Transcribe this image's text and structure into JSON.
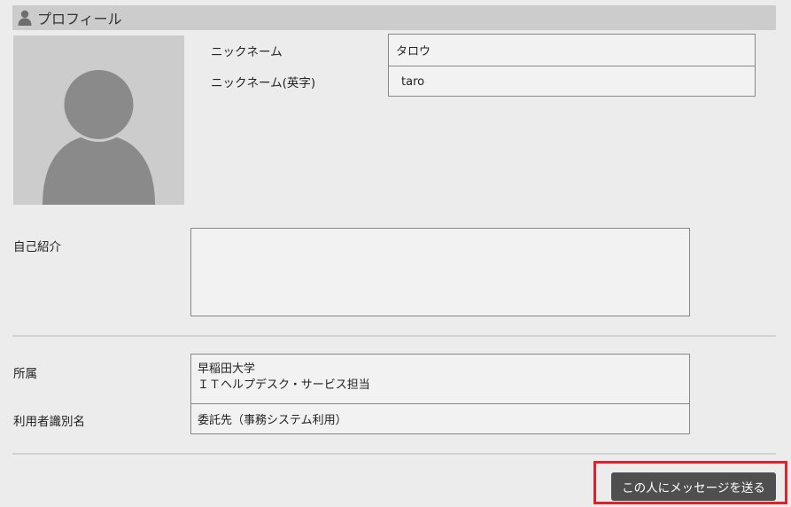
{
  "header": {
    "icon": "user-icon",
    "title": "プロフィール"
  },
  "profile": {
    "avatar_icon": "avatar-placeholder-icon",
    "nickname_label": "ニックネーム",
    "nickname_value": "タロウ",
    "nickname_en_label": "ニックネーム(英字)",
    "nickname_en_value": "taro",
    "intro_label": "自己紹介",
    "intro_value": ""
  },
  "affiliation": {
    "label": "所属",
    "lines": [
      "早稲田大学",
      "ＩＴヘルプデスク・サービス担当"
    ],
    "user_id_label": "利用者識別名",
    "user_id_value": "委託先（事務システム利用）"
  },
  "actions": {
    "send_message_label": "この人にメッセージを送る"
  },
  "colors": {
    "background": "#ececec",
    "header_bg": "#cccccc",
    "button_bg": "#4f4f4f",
    "highlight": "#e0202a"
  }
}
